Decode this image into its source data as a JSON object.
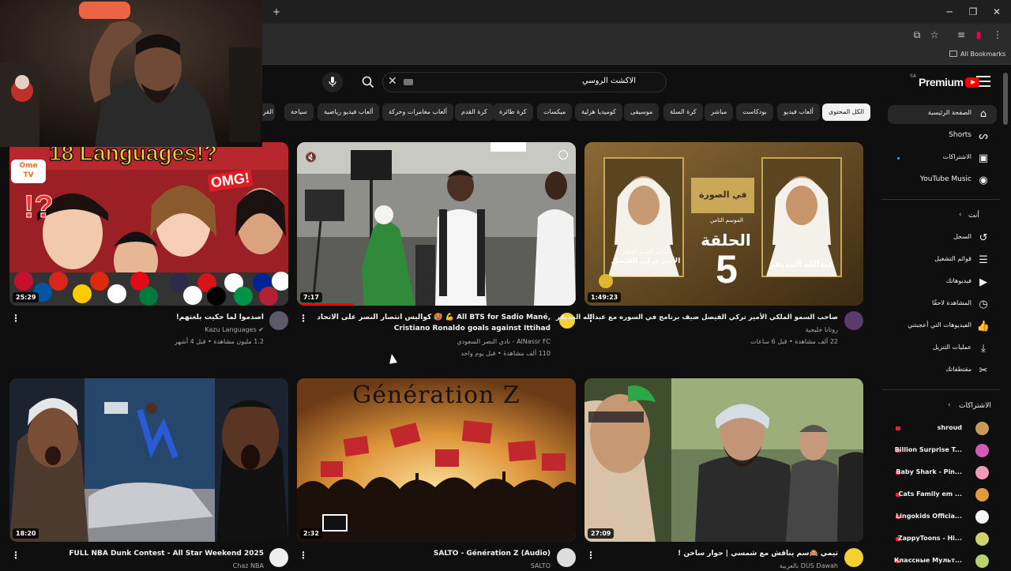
{
  "window": {
    "new_tab": "+",
    "minimize": "─",
    "maximize": "❐",
    "close": "✕",
    "all_bookmarks": "All Bookmarks"
  },
  "header": {
    "logo_text": "Premium",
    "region": "SA",
    "search_query": "الاكشت الروسي",
    "search_icon": "search-icon",
    "mic_icon": "mic-icon"
  },
  "chips": [
    "الكل المحتوى",
    "ألعاب فيديو",
    "بودكاست",
    "مباشر",
    "كرة السلة",
    "موسيقى",
    "كوميديا هزلية",
    "ميكسات",
    "كرة طائرة",
    "كرة القدم",
    "ألعاب مغامرات وحركة",
    "ألعاب فيديو رياضية",
    "سياحة",
    "القر"
  ],
  "sidebar": {
    "main": [
      {
        "label": "الصفحة الرئيسية",
        "icon": "home-icon"
      },
      {
        "label": "Shorts",
        "icon": "shorts-icon"
      },
      {
        "label": "الاشتراكات",
        "icon": "subscriptions-icon"
      },
      {
        "label": "YouTube Music",
        "icon": "music-icon"
      }
    ],
    "you_header": "أنت",
    "you": [
      {
        "label": "السجل",
        "icon": "history-icon"
      },
      {
        "label": "قوائم التشغيل",
        "icon": "playlist-icon"
      },
      {
        "label": "فيديوهاتك",
        "icon": "your-videos-icon"
      },
      {
        "label": "المشاهدة لاحقًا",
        "icon": "watch-later-icon"
      },
      {
        "label": "الفيديوهات التي أعجبتني",
        "icon": "like-icon"
      },
      {
        "label": "عمليات التنزيل",
        "icon": "download-icon"
      },
      {
        "label": "مقتطفاتك",
        "icon": "clips-icon"
      }
    ],
    "subs_header": "الاشتراكات",
    "subscriptions": [
      {
        "name": "shroud",
        "color": "#c89a55"
      },
      {
        "name": "Billion Surprise T...",
        "color": "#d35ab9"
      },
      {
        "name": "Baby Shark - Pin...",
        "color": "#f29ab8"
      },
      {
        "name": "Cats Family em ...",
        "color": "#e39a3c"
      },
      {
        "name": "Lingokids Officia...",
        "color": "#f5f5f5"
      },
      {
        "name": "ZappyToons - Hi...",
        "color": "#cfd36b"
      },
      {
        "name": "Классные Мульт...",
        "color": "#b9d36f"
      }
    ]
  },
  "videos": [
    {
      "title": "اصدموا لما حكيت بلغتهم!",
      "channel": "Kazu Languages",
      "meta": "1.2 مليون مشاهدة • قبل 4 أشهر",
      "duration": "25:29",
      "thumb_text_1": "18 Languages!?",
      "thumb_text_2": "OMG!",
      "thumb_badge": "Ome TV"
    },
    {
      "title": "كواليس انتصار النصر على الاتحاد 🥵 💪 All BTS for Sadio Mané,",
      "title_2": "Cristiano Ronaldo goals against Ittihad",
      "channel": "AlNassr FC - نادي النصر السعودي",
      "meta": "110 ألف مشاهدة • قبل يوم واحد",
      "duration": "7:17"
    },
    {
      "title": "صاحب السمو الملكي الأمير تركي الفيصل ضيف برنامج في السوره مع عبدالله المديفر",
      "channel": "روتانا خليجية",
      "meta": "22 ألف مشاهدة • قبل 6 ساعات",
      "duration": "1:49:23",
      "thumb_episode": "الحلقة",
      "thumb_number": "5",
      "thumb_guest": "الأمير تركي الفيصل",
      "thumb_guest_title": "صاحب السمو الملكي",
      "thumb_host": "عبدالله المديفر",
      "thumb_show": "في الصورة",
      "thumb_season": "الموسم الثامن"
    },
    {
      "title": "FULL NBA Dunk Contest - All Star Weekend 2025",
      "channel": "Chaz NBA",
      "duration": "18:20"
    },
    {
      "title": "SALTO - Génération Z (Audio)",
      "channel": "SALTO",
      "duration": "2:32",
      "thumb_text": "Génération Z"
    },
    {
      "title": "تيمي 🙈سم يناقش مع شمسي | حوار ساخن !",
      "channel": "DUS Dawah بالعربية",
      "duration": "27:09"
    }
  ],
  "colors": {
    "background": "#0f0f0f",
    "chip": "#272727",
    "brand_red": "#ff0000"
  }
}
